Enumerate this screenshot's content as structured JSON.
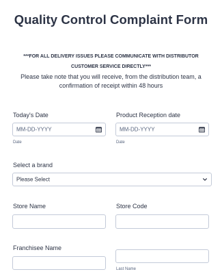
{
  "form": {
    "title": "Quality Control Complaint Form",
    "notice": "***FOR ALL DELIVERY ISSUES PLEASE COMMUNICATE WITH DISTRIBUTOR CUSTOMER SERVICE DIRECTLY***",
    "description": "Please take note that you will receive, from the distribution team, a confirmation of receipt within 48 hours"
  },
  "fields": {
    "todays_date": {
      "label": "Today's Date",
      "placeholder": "MM-DD-YYYY",
      "sublabel": "Date"
    },
    "reception_date": {
      "label": "Product Reception date",
      "placeholder": "MM-DD-YYYY",
      "sublabel": "Date"
    },
    "brand": {
      "label": "Select a brand",
      "selected": "Please Select"
    },
    "store_name": {
      "label": "Store Name",
      "value": ""
    },
    "store_code": {
      "label": "Store Code",
      "value": ""
    },
    "franchisee_name": {
      "label": "Franchisee Name",
      "first_value": "",
      "last_value": "",
      "last_sublabel": "Last Name"
    }
  },
  "icons": {
    "date_picker": "calendar-icon",
    "dropdown": "chevron-down-icon"
  }
}
